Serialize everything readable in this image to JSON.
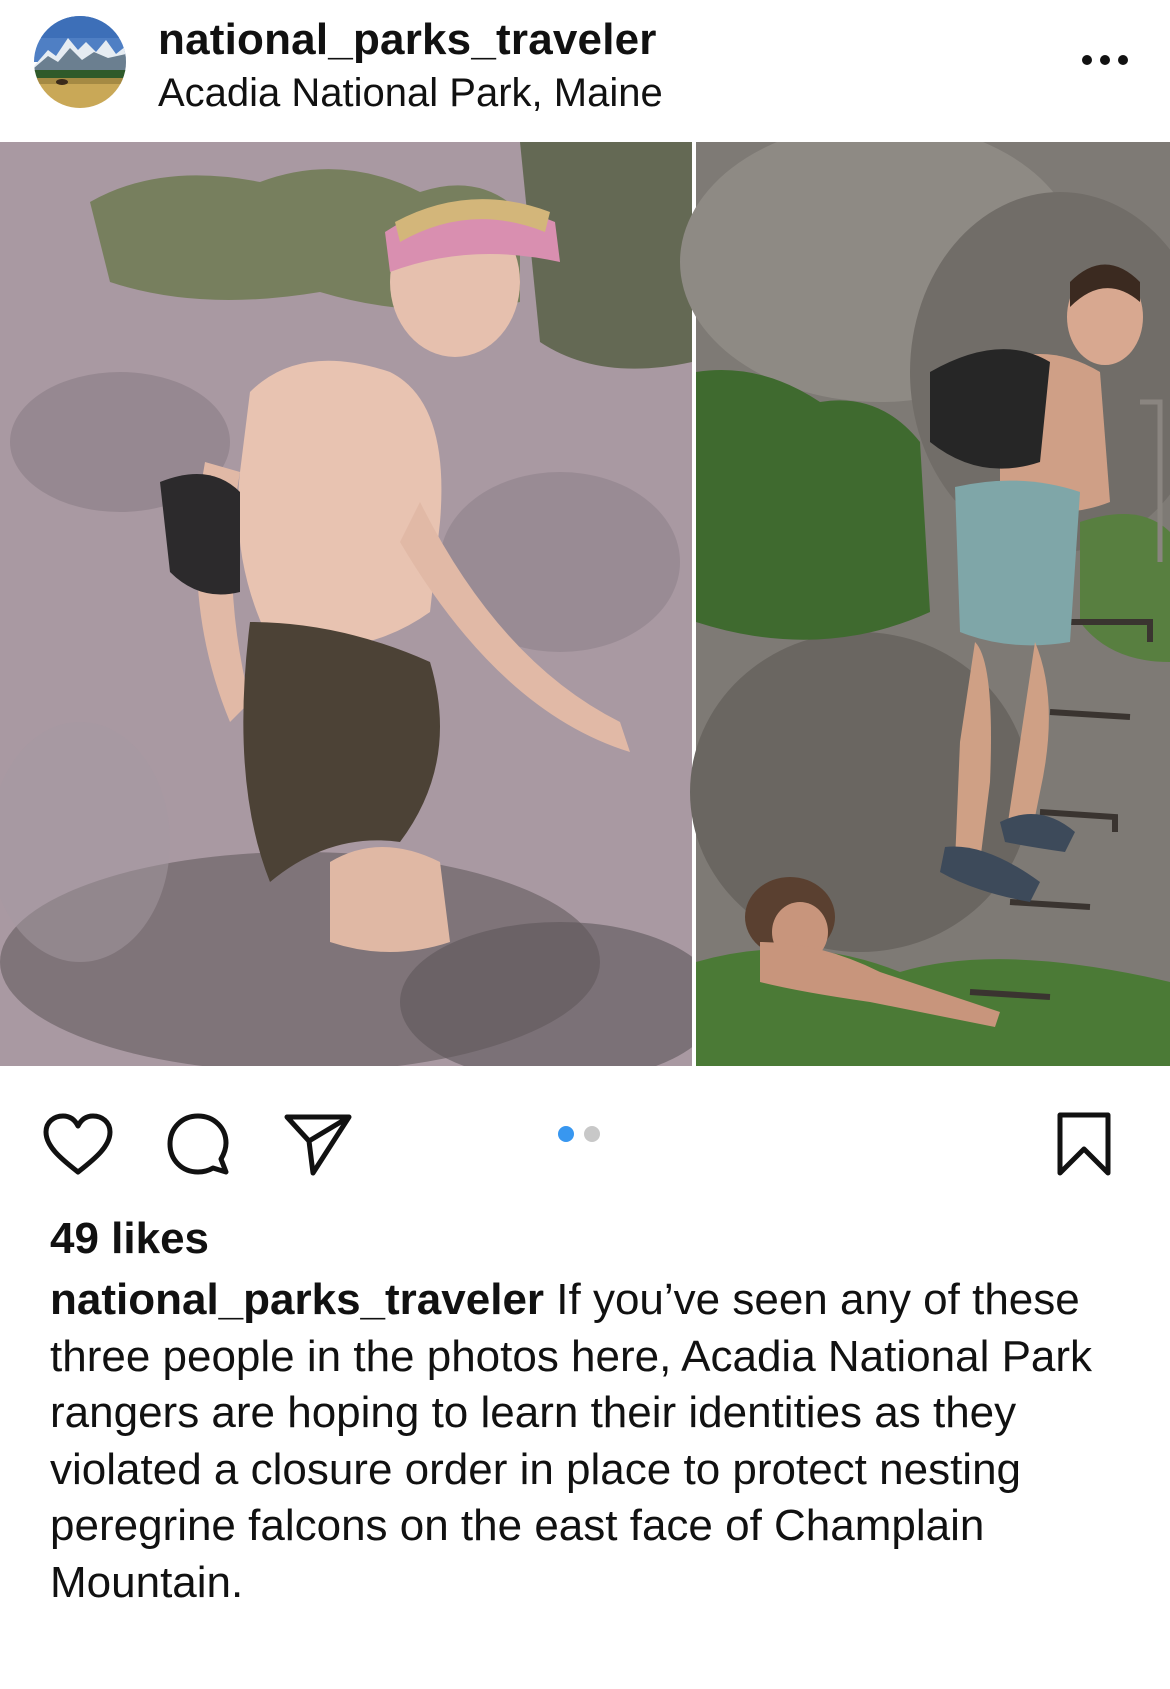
{
  "header": {
    "username": "national_parks_traveler",
    "location": "Acadia National Park, Maine",
    "more_icon": "more-horizontal-icon"
  },
  "carousel": {
    "total_slides": 2,
    "current_slide": 1
  },
  "actions": {
    "like_icon": "heart-icon",
    "comment_icon": "comment-icon",
    "share_icon": "share-icon",
    "save_icon": "bookmark-icon"
  },
  "likes": "49 likes",
  "caption": {
    "username": "national_parks_traveler",
    "text": "If you’ve seen any of these three people in the photos here, Acadia National Park rangers are hoping to learn their identities as they violated a closure order in place to protect nesting peregrine falcons on the east face of Champlain Mountain."
  },
  "colors": {
    "carousel_active_dot": "#3897f0",
    "carousel_inactive_dot": "#c8c8c8",
    "text": "#111111"
  }
}
